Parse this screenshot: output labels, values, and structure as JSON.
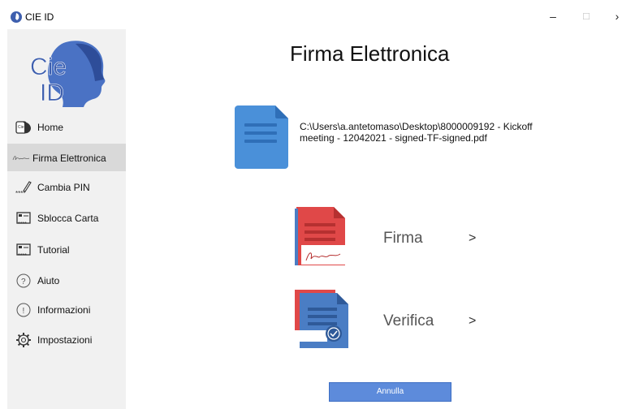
{
  "window": {
    "title": "CIE ID",
    "minimize_label": "–",
    "maximize_label": "□",
    "close_label": "›"
  },
  "sidebar": {
    "logo_icon": "cie-id-logo",
    "items": [
      {
        "label": "Home",
        "icon": "cie-card-icon",
        "active": false
      },
      {
        "label": "Firma Elettronica",
        "icon": "signature-icon",
        "active": true
      },
      {
        "label": "Cambia PIN",
        "icon": "pen-pin-icon",
        "active": false
      },
      {
        "label": "Sblocca Carta",
        "icon": "unlock-card-icon",
        "active": false
      },
      {
        "label": "Tutorial",
        "icon": "tutorial-icon",
        "active": false
      },
      {
        "label": "Aiuto",
        "icon": "help-icon",
        "active": false
      },
      {
        "label": "Informazioni",
        "icon": "info-icon",
        "active": false
      },
      {
        "label": "Impostazioni",
        "icon": "gear-icon",
        "active": false
      }
    ]
  },
  "main": {
    "title": "Firma Elettronica",
    "file_path": "C:\\Users\\a.antetomaso\\Desktop\\8000009192 - Kickoff meeting - 12042021 - signed-TF-signed.pdf",
    "actions": [
      {
        "label": "Firma",
        "chevron": ">",
        "icon": "sign-document-icon"
      },
      {
        "label": "Verifica",
        "chevron": ">",
        "icon": "verify-document-icon"
      }
    ],
    "cancel_label": "Annulla"
  },
  "colors": {
    "sidebar_bg": "#f1f1f1",
    "active_item_bg": "#d9d9d9",
    "accent_blue": "#4a90d9",
    "button_blue": "#5d8bdb",
    "doc_red": "#e04848",
    "logo_blue": "#3e5fae"
  }
}
